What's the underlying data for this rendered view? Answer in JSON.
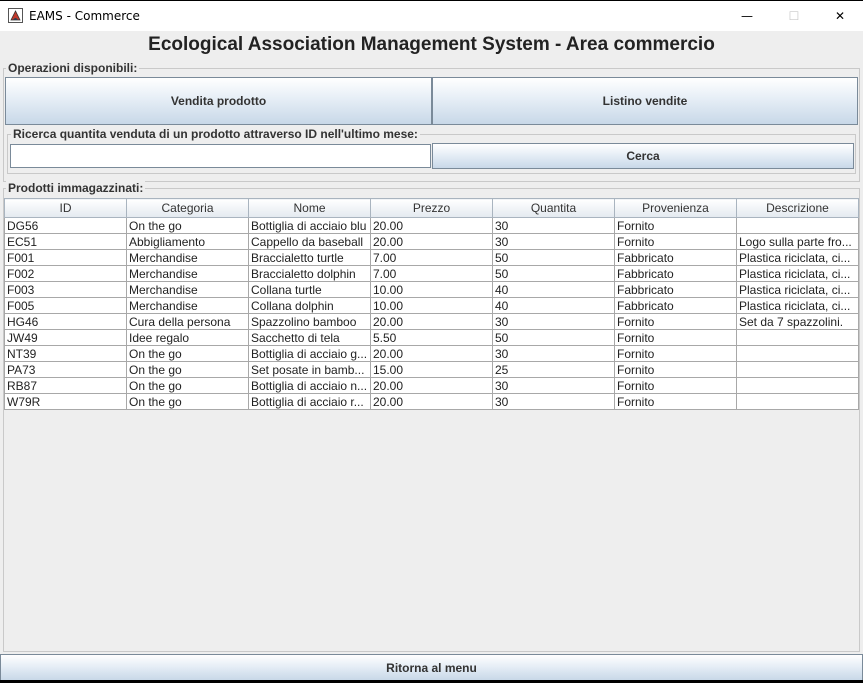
{
  "window": {
    "title": "EAMS - Commerce",
    "controls": {
      "minimize": "—",
      "maximize": "☐",
      "close": "✕"
    }
  },
  "header": {
    "title": "Ecological Association Management System - Area commercio"
  },
  "operations": {
    "group_label": "Operazioni disponibili:",
    "sell_button": "Vendita prodotto",
    "list_button": "Listino vendite"
  },
  "search": {
    "group_label": "Ricerca quantita venduta di un prodotto attraverso ID nell'ultimo mese:",
    "value": "",
    "button": "Cerca"
  },
  "products": {
    "group_label": "Prodotti immagazzinati:",
    "columns": [
      "ID",
      "Categoria",
      "Nome",
      "Prezzo",
      "Quantita",
      "Provenienza",
      "Descrizione"
    ],
    "rows": [
      [
        "DG56",
        "On the go",
        "Bottiglia di acciaio blu",
        "20.00",
        "30",
        "Fornito",
        ""
      ],
      [
        "EC51",
        "Abbigliamento",
        "Cappello da baseball",
        "20.00",
        "30",
        "Fornito",
        "Logo sulla parte fro..."
      ],
      [
        "F001",
        "Merchandise",
        "Braccialetto turtle",
        "7.00",
        "50",
        "Fabbricato",
        "Plastica riciclata, ci..."
      ],
      [
        "F002",
        "Merchandise",
        "Braccialetto dolphin",
        "7.00",
        "50",
        "Fabbricato",
        "Plastica riciclata, ci..."
      ],
      [
        "F003",
        "Merchandise",
        "Collana turtle",
        "10.00",
        "40",
        "Fabbricato",
        "Plastica riciclata, ci..."
      ],
      [
        "F005",
        "Merchandise",
        "Collana dolphin",
        "10.00",
        "40",
        "Fabbricato",
        "Plastica riciclata, ci..."
      ],
      [
        "HG46",
        "Cura della persona",
        "Spazzolino bamboo",
        "20.00",
        "30",
        "Fornito",
        "Set da 7 spazzolini."
      ],
      [
        "JW49",
        "Idee regalo",
        "Sacchetto di tela",
        "5.50",
        "50",
        "Fornito",
        ""
      ],
      [
        "NT39",
        "On the go",
        "Bottiglia di acciaio g...",
        "20.00",
        "30",
        "Fornito",
        ""
      ],
      [
        "PA73",
        "On the go",
        "Set posate in bamb...",
        "15.00",
        "25",
        "Fornito",
        ""
      ],
      [
        "RB87",
        "On the go",
        "Bottiglia di acciaio n...",
        "20.00",
        "30",
        "Fornito",
        ""
      ],
      [
        "W79R",
        "On the go",
        "Bottiglia di acciaio r...",
        "20.00",
        "30",
        "Fornito",
        ""
      ]
    ]
  },
  "footer": {
    "back_button": "Ritorna al menu"
  }
}
